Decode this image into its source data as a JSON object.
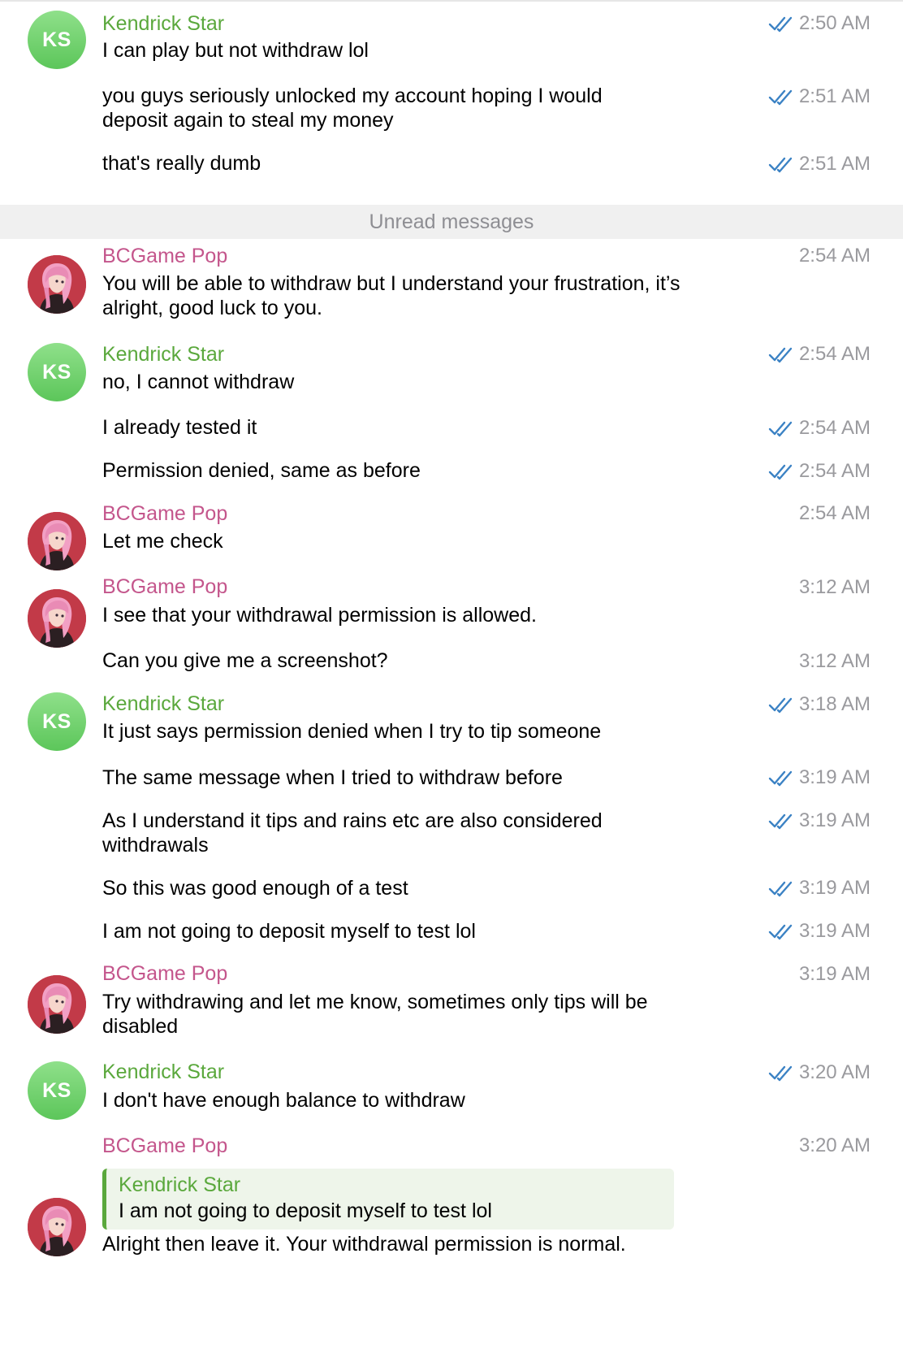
{
  "participants": {
    "ks": {
      "name": "Kendrick Star",
      "initials": "KS",
      "color": "#5aa83c"
    },
    "bc": {
      "name": "BCGame Pop",
      "color": "#c4568c"
    }
  },
  "unread_label": "Unread messages",
  "messages": [
    {
      "text": "I can play but not withdraw lol",
      "time": "2:50 AM",
      "read": true
    },
    {
      "text": "you guys seriously unlocked my account hoping I would",
      "text2": "deposit again to steal my money",
      "time": "2:51 AM",
      "read": true
    },
    {
      "text": "that's really dumb",
      "time": "2:51 AM",
      "read": true
    },
    {
      "text": "You will be able to withdraw but I understand your frustration, it’s",
      "text2": "alright, good luck to you.",
      "time": "2:54 AM"
    },
    {
      "text": "no, I cannot withdraw",
      "time": "2:54 AM",
      "read": true
    },
    {
      "text": "I already tested it",
      "time": "2:54 AM",
      "read": true
    },
    {
      "text": "Permission denied, same as before",
      "time": "2:54 AM",
      "read": true
    },
    {
      "text": "Let me check",
      "time": "2:54 AM"
    },
    {
      "text": "I see that your withdrawal permission is allowed.",
      "time": "3:12 AM"
    },
    {
      "text": "Can you give me a screenshot?",
      "time": "3:12 AM"
    },
    {
      "text": "It just says permission denied when I try to tip someone",
      "time": "3:18 AM",
      "read": true
    },
    {
      "text": "The same message when I tried to withdraw before",
      "time": "3:19 AM",
      "read": true
    },
    {
      "text": "As I understand it tips and rains etc are also considered",
      "text2": "withdrawals",
      "time": "3:19 AM",
      "read": true
    },
    {
      "text": "So this was good enough of a test",
      "time": "3:19 AM",
      "read": true
    },
    {
      "text": "I am not going to deposit myself to test lol",
      "time": "3:19 AM",
      "read": true
    },
    {
      "text": "Try withdrawing and let me know, sometimes only tips will be",
      "text2": "disabled",
      "time": "3:19 AM"
    },
    {
      "text": "I don't have enough balance to withdraw",
      "time": "3:20 AM",
      "read": true
    },
    {
      "text": "Alright then leave it. Your withdrawal permission is normal.",
      "time": "3:20 AM",
      "reply": {
        "name": "Kendrick Star",
        "text": "I am not going to deposit myself to test lol"
      }
    }
  ],
  "icons": {
    "read_receipt": "double-check-icon",
    "avatar_bc": "anime-avatar-icon"
  },
  "colors": {
    "read_check": "#3b82c4",
    "unread_bar_bg": "#f0f0f0",
    "reply_bg": "#eef5ea"
  }
}
